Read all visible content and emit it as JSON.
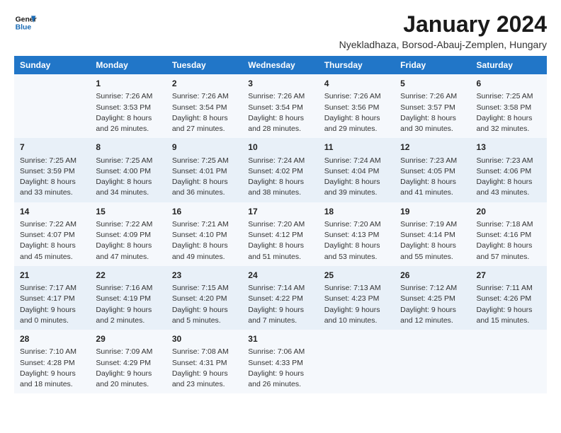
{
  "logo": {
    "line1": "General",
    "line2": "Blue"
  },
  "title": "January 2024",
  "subtitle": "Nyekladhaza, Borsod-Abauj-Zemplen, Hungary",
  "headers": [
    "Sunday",
    "Monday",
    "Tuesday",
    "Wednesday",
    "Thursday",
    "Friday",
    "Saturday"
  ],
  "weeks": [
    [
      {
        "day": "",
        "sunrise": "",
        "sunset": "",
        "daylight": ""
      },
      {
        "day": "1",
        "sunrise": "Sunrise: 7:26 AM",
        "sunset": "Sunset: 3:53 PM",
        "daylight": "Daylight: 8 hours and 26 minutes."
      },
      {
        "day": "2",
        "sunrise": "Sunrise: 7:26 AM",
        "sunset": "Sunset: 3:54 PM",
        "daylight": "Daylight: 8 hours and 27 minutes."
      },
      {
        "day": "3",
        "sunrise": "Sunrise: 7:26 AM",
        "sunset": "Sunset: 3:54 PM",
        "daylight": "Daylight: 8 hours and 28 minutes."
      },
      {
        "day": "4",
        "sunrise": "Sunrise: 7:26 AM",
        "sunset": "Sunset: 3:56 PM",
        "daylight": "Daylight: 8 hours and 29 minutes."
      },
      {
        "day": "5",
        "sunrise": "Sunrise: 7:26 AM",
        "sunset": "Sunset: 3:57 PM",
        "daylight": "Daylight: 8 hours and 30 minutes."
      },
      {
        "day": "6",
        "sunrise": "Sunrise: 7:25 AM",
        "sunset": "Sunset: 3:58 PM",
        "daylight": "Daylight: 8 hours and 32 minutes."
      }
    ],
    [
      {
        "day": "7",
        "sunrise": "Sunrise: 7:25 AM",
        "sunset": "Sunset: 3:59 PM",
        "daylight": "Daylight: 8 hours and 33 minutes."
      },
      {
        "day": "8",
        "sunrise": "Sunrise: 7:25 AM",
        "sunset": "Sunset: 4:00 PM",
        "daylight": "Daylight: 8 hours and 34 minutes."
      },
      {
        "day": "9",
        "sunrise": "Sunrise: 7:25 AM",
        "sunset": "Sunset: 4:01 PM",
        "daylight": "Daylight: 8 hours and 36 minutes."
      },
      {
        "day": "10",
        "sunrise": "Sunrise: 7:24 AM",
        "sunset": "Sunset: 4:02 PM",
        "daylight": "Daylight: 8 hours and 38 minutes."
      },
      {
        "day": "11",
        "sunrise": "Sunrise: 7:24 AM",
        "sunset": "Sunset: 4:04 PM",
        "daylight": "Daylight: 8 hours and 39 minutes."
      },
      {
        "day": "12",
        "sunrise": "Sunrise: 7:23 AM",
        "sunset": "Sunset: 4:05 PM",
        "daylight": "Daylight: 8 hours and 41 minutes."
      },
      {
        "day": "13",
        "sunrise": "Sunrise: 7:23 AM",
        "sunset": "Sunset: 4:06 PM",
        "daylight": "Daylight: 8 hours and 43 minutes."
      }
    ],
    [
      {
        "day": "14",
        "sunrise": "Sunrise: 7:22 AM",
        "sunset": "Sunset: 4:07 PM",
        "daylight": "Daylight: 8 hours and 45 minutes."
      },
      {
        "day": "15",
        "sunrise": "Sunrise: 7:22 AM",
        "sunset": "Sunset: 4:09 PM",
        "daylight": "Daylight: 8 hours and 47 minutes."
      },
      {
        "day": "16",
        "sunrise": "Sunrise: 7:21 AM",
        "sunset": "Sunset: 4:10 PM",
        "daylight": "Daylight: 8 hours and 49 minutes."
      },
      {
        "day": "17",
        "sunrise": "Sunrise: 7:20 AM",
        "sunset": "Sunset: 4:12 PM",
        "daylight": "Daylight: 8 hours and 51 minutes."
      },
      {
        "day": "18",
        "sunrise": "Sunrise: 7:20 AM",
        "sunset": "Sunset: 4:13 PM",
        "daylight": "Daylight: 8 hours and 53 minutes."
      },
      {
        "day": "19",
        "sunrise": "Sunrise: 7:19 AM",
        "sunset": "Sunset: 4:14 PM",
        "daylight": "Daylight: 8 hours and 55 minutes."
      },
      {
        "day": "20",
        "sunrise": "Sunrise: 7:18 AM",
        "sunset": "Sunset: 4:16 PM",
        "daylight": "Daylight: 8 hours and 57 minutes."
      }
    ],
    [
      {
        "day": "21",
        "sunrise": "Sunrise: 7:17 AM",
        "sunset": "Sunset: 4:17 PM",
        "daylight": "Daylight: 9 hours and 0 minutes."
      },
      {
        "day": "22",
        "sunrise": "Sunrise: 7:16 AM",
        "sunset": "Sunset: 4:19 PM",
        "daylight": "Daylight: 9 hours and 2 minutes."
      },
      {
        "day": "23",
        "sunrise": "Sunrise: 7:15 AM",
        "sunset": "Sunset: 4:20 PM",
        "daylight": "Daylight: 9 hours and 5 minutes."
      },
      {
        "day": "24",
        "sunrise": "Sunrise: 7:14 AM",
        "sunset": "Sunset: 4:22 PM",
        "daylight": "Daylight: 9 hours and 7 minutes."
      },
      {
        "day": "25",
        "sunrise": "Sunrise: 7:13 AM",
        "sunset": "Sunset: 4:23 PM",
        "daylight": "Daylight: 9 hours and 10 minutes."
      },
      {
        "day": "26",
        "sunrise": "Sunrise: 7:12 AM",
        "sunset": "Sunset: 4:25 PM",
        "daylight": "Daylight: 9 hours and 12 minutes."
      },
      {
        "day": "27",
        "sunrise": "Sunrise: 7:11 AM",
        "sunset": "Sunset: 4:26 PM",
        "daylight": "Daylight: 9 hours and 15 minutes."
      }
    ],
    [
      {
        "day": "28",
        "sunrise": "Sunrise: 7:10 AM",
        "sunset": "Sunset: 4:28 PM",
        "daylight": "Daylight: 9 hours and 18 minutes."
      },
      {
        "day": "29",
        "sunrise": "Sunrise: 7:09 AM",
        "sunset": "Sunset: 4:29 PM",
        "daylight": "Daylight: 9 hours and 20 minutes."
      },
      {
        "day": "30",
        "sunrise": "Sunrise: 7:08 AM",
        "sunset": "Sunset: 4:31 PM",
        "daylight": "Daylight: 9 hours and 23 minutes."
      },
      {
        "day": "31",
        "sunrise": "Sunrise: 7:06 AM",
        "sunset": "Sunset: 4:33 PM",
        "daylight": "Daylight: 9 hours and 26 minutes."
      },
      {
        "day": "",
        "sunrise": "",
        "sunset": "",
        "daylight": ""
      },
      {
        "day": "",
        "sunrise": "",
        "sunset": "",
        "daylight": ""
      },
      {
        "day": "",
        "sunrise": "",
        "sunset": "",
        "daylight": ""
      }
    ]
  ]
}
